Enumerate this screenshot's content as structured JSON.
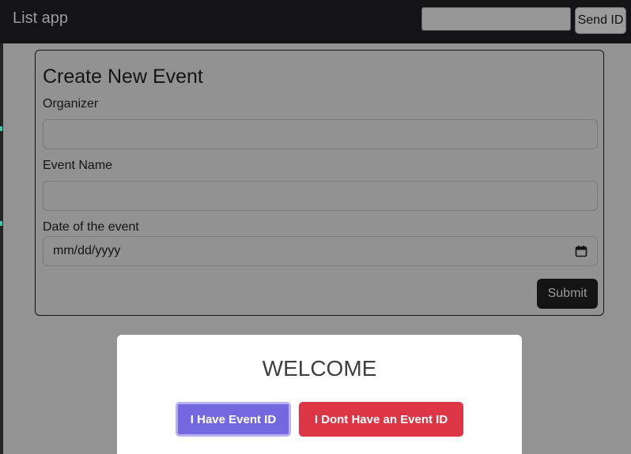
{
  "navbar": {
    "brand": "List app",
    "id_input_value": "",
    "send_button_label": "Send ID"
  },
  "form": {
    "title": "Create New Event",
    "organizer_label": "Organizer",
    "organizer_value": "",
    "event_name_label": "Event Name",
    "event_name_value": "",
    "date_label": "Date of the event",
    "date_placeholder": "mm/dd/yyyy",
    "submit_label": "Submit"
  },
  "modal": {
    "title": "WELCOME",
    "have_id_label": "I Have Event ID",
    "no_id_label": "I Dont Have an Event ID"
  },
  "icons": {
    "calendar": "calendar-icon"
  },
  "colors": {
    "navbar_bg": "#141418",
    "overlay": "#939393",
    "primary_button": "#7468e0",
    "danger_button": "#dc3545",
    "dark_button": "#141414"
  }
}
